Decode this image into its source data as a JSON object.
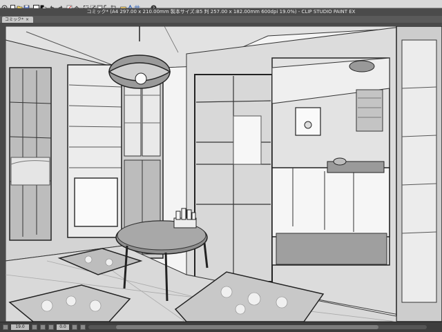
{
  "app": {
    "title": "コミック* (A4 297.00 x 210.00mm 製本サイズ:B5 判 257.00 x 182.00mm 600dpi 19.0%) - CLIP STUDIO PAINT EX"
  },
  "tabs": [
    {
      "label": "コミック*"
    }
  ],
  "toolbar": {
    "icons": [
      "app-menu-icon",
      "new-icon",
      "open-icon",
      "save-icon",
      "undo-icon",
      "redo-icon",
      "clear-icon",
      "fill-icon",
      "transform-icon",
      "deselect-icon",
      "invert-icon",
      "expand-icon",
      "crop-icon",
      "ruler-icon",
      "snap-icon",
      "grid-icon",
      "help-icon"
    ]
  },
  "status": {
    "zoom": "19.0",
    "angle": "0.0"
  },
  "colors": {
    "ui_dark": "#3a3a3a",
    "toolbar": "#d8d8d8",
    "canvas_bg": "#3c3c3c"
  }
}
